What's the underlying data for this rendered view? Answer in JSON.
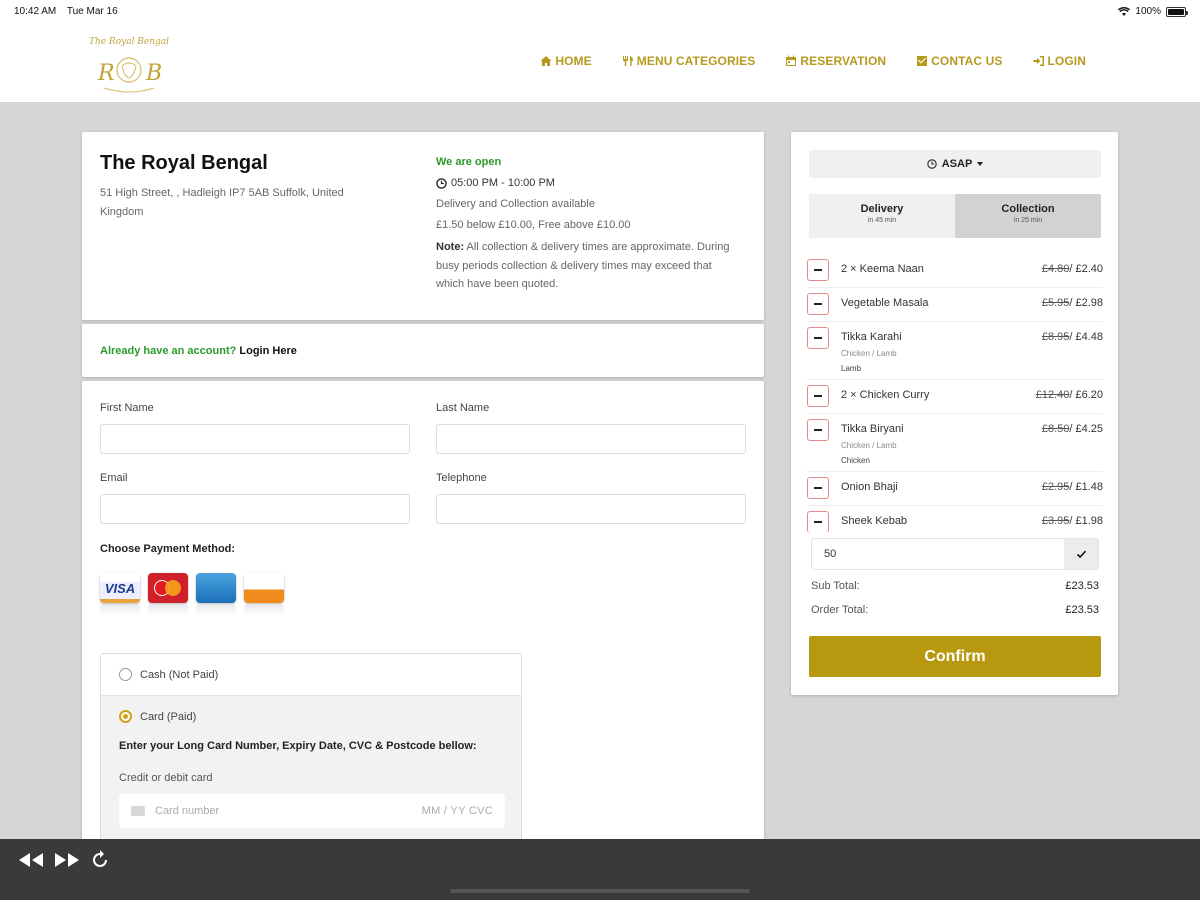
{
  "status": {
    "time": "10:42 AM",
    "date": "Tue Mar 16",
    "battery": "100%"
  },
  "nav": [
    {
      "label": "HOME",
      "icon": "home-icon"
    },
    {
      "label": "MENU CATEGORIES",
      "icon": "cutlery-icon"
    },
    {
      "label": "RESERVATION",
      "icon": "calendar-icon"
    },
    {
      "label": "CONTAC US",
      "icon": "contact-icon"
    },
    {
      "label": "LOGIN",
      "icon": "login-icon"
    }
  ],
  "logo": {
    "top_text": "The Royal Bengal",
    "monogram_left": "R",
    "monogram_right": "B"
  },
  "restaurant": {
    "name": "The Royal Bengal",
    "address": "51 High Street, , Hadleigh IP7 5AB Suffolk, United Kingdom",
    "open_status": "We are open",
    "hours": "05:00 PM - 10:00 PM",
    "service": "Delivery and Collection available",
    "fee": "£1.50 below £10.00, Free above £10.00",
    "note_label": "Note:",
    "note_text": " All collection & delivery times are approximate. During busy periods collection & delivery times may exceed that which have been quoted."
  },
  "login": {
    "question": "Already have an account?",
    "link": "Login Here"
  },
  "form": {
    "first_name_label": "First Name",
    "last_name_label": "Last Name",
    "email_label": "Email",
    "telephone_label": "Telephone",
    "first_name_value": "",
    "last_name_value": "",
    "email_value": "",
    "telephone_value": "",
    "payment_title": "Choose Payment Method:",
    "cash_label": "Cash (Not Paid)",
    "card_label": "Card (Paid)",
    "card_instructions": "Enter your Long Card Number, Expiry Date, CVC & Postcode bellow:",
    "card_field_label": "Credit or debit card",
    "card_number_placeholder": "Card number",
    "card_meta_placeholder": "MM / YY  CVC"
  },
  "card_logos": [
    "VISA",
    "MasterCard",
    "AMERICAN EXPRESS",
    "DISCOVER"
  ],
  "order": {
    "time_label": "ASAP",
    "delivery_label": "Delivery",
    "delivery_time": "in 45 min",
    "collection_label": "Collection",
    "collection_time": "in 25 min",
    "items": [
      {
        "name": "2 × Keema Naan",
        "old": "£4.80",
        "new": "/ £2.40",
        "sub": "",
        "sel": ""
      },
      {
        "name": "Vegetable Masala",
        "old": "£5.95",
        "new": "/ £2.98",
        "sub": "",
        "sel": ""
      },
      {
        "name": "Tikka Karahi",
        "old": "£8.95",
        "new": "/ £4.48",
        "sub": "Chicken / Lamb",
        "sel": "Lamb"
      },
      {
        "name": "2 × Chicken Curry",
        "old": "£12.40",
        "new": "/ £6.20",
        "sub": "",
        "sel": ""
      },
      {
        "name": "Tikka Biryani",
        "old": "£8.50",
        "new": "/ £4.25",
        "sub": "Chicken / Lamb",
        "sel": "Chicken"
      },
      {
        "name": "Onion Bhaji",
        "old": "£2.95",
        "new": "/ £1.48",
        "sub": "",
        "sel": ""
      },
      {
        "name": "Sheek Kebab",
        "old": "£3.95",
        "new": "/ £1.98",
        "sub": "",
        "sel": ""
      }
    ],
    "coupon_value": "50",
    "subtotal_label": "Sub Total:",
    "subtotal_value": "£23.53",
    "ordertotal_label": "Order Total:",
    "ordertotal_value": "£23.53",
    "confirm_label": "Confirm"
  },
  "colors": {
    "brand_gold": "#b59a1e",
    "confirm_bg": "#b8980f",
    "open_green": "#2a9a2a"
  }
}
